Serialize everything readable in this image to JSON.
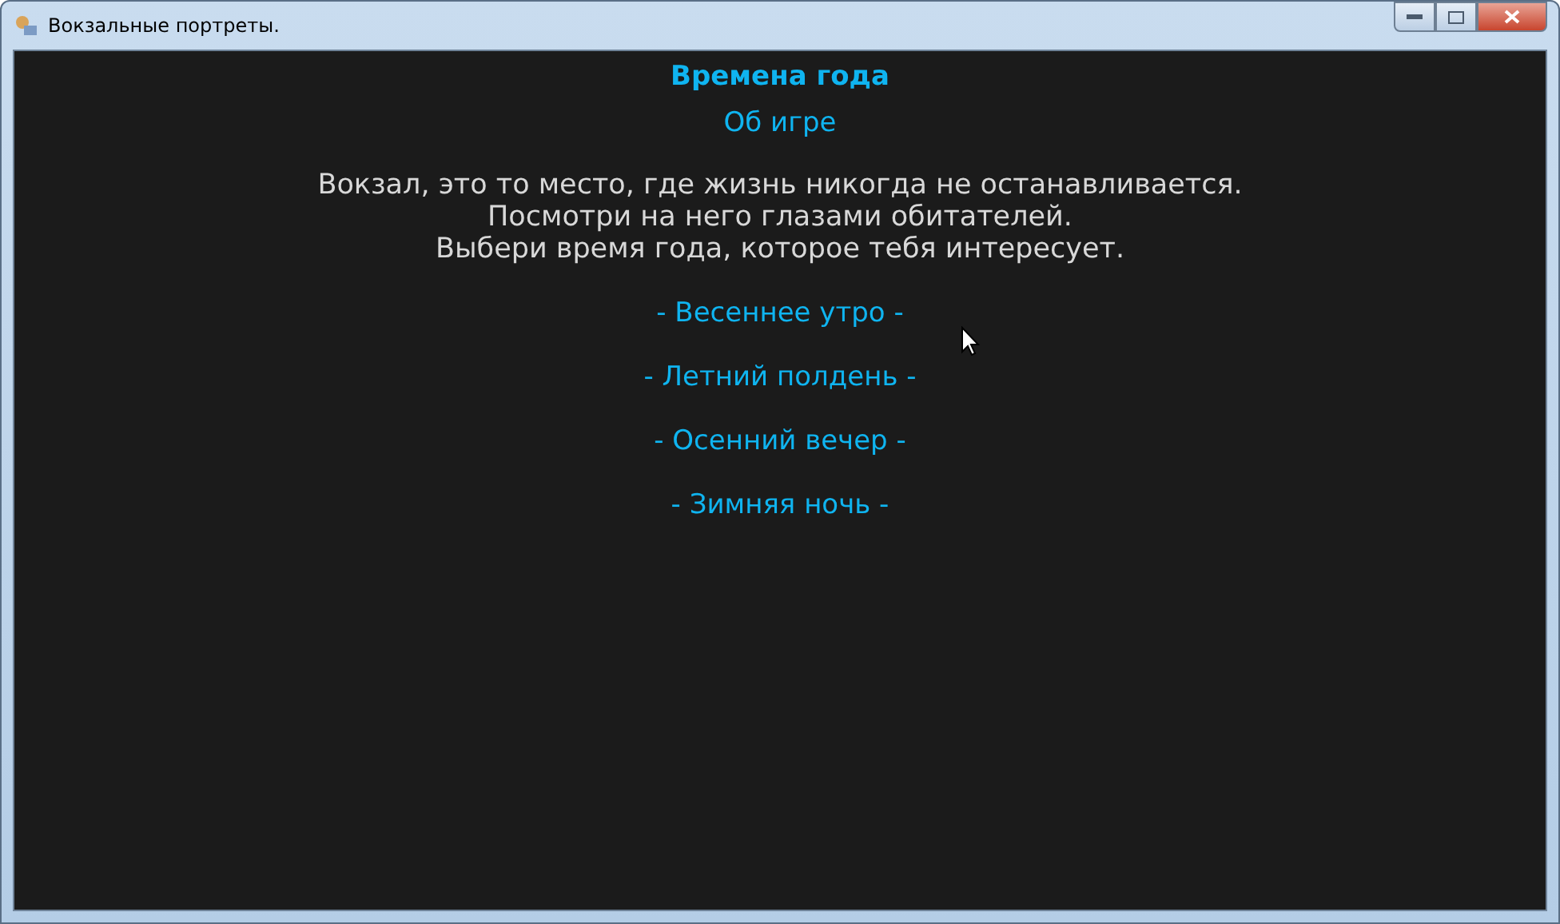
{
  "window": {
    "title": "Вокзальные портреты."
  },
  "heading": "Времена года",
  "about_link": "Об игре",
  "intro_lines": [
    "Вокзал, это то место, где жизнь никогда не останавливается.",
    "Посмотри на него глазами обитателей.",
    "Выбери время года, которое тебя интересует."
  ],
  "seasons": [
    "- Весеннее утро -",
    "- Летний полдень -",
    "- Осенний вечер -",
    "- Зимняя ночь -"
  ]
}
